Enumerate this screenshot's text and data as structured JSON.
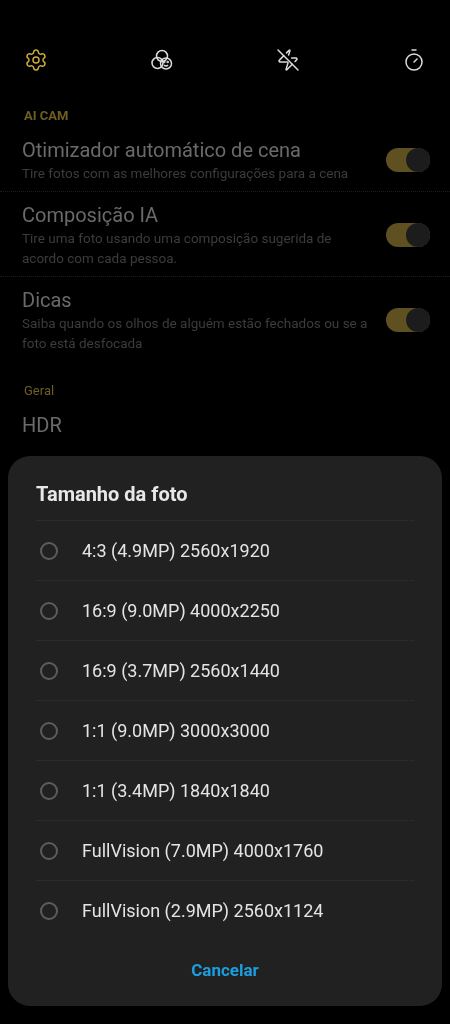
{
  "toolbar": [
    {
      "kind": "settings",
      "selected": true
    },
    {
      "kind": "filter",
      "selected": false
    },
    {
      "kind": "flash-off",
      "selected": false
    },
    {
      "kind": "timer",
      "selected": false
    }
  ],
  "sections": [
    {
      "header": "AI CAM",
      "items": [
        {
          "title": "Otimizador automático de cena",
          "subtitle": "Tire fotos com as melhores configurações para a cena",
          "on": true
        },
        {
          "title": "Composição IA",
          "subtitle": "Tire uma foto usando uma composição sugerida de acordo com cada pessoa.",
          "on": true
        },
        {
          "title": "Dicas",
          "subtitle": "Saiba quando os olhos de alguém estão fechados ou se a foto está desfocada",
          "on": true
        }
      ]
    },
    {
      "header": "Geral",
      "items": [
        {
          "title": "HDR"
        }
      ]
    }
  ],
  "dialog": {
    "title": "Tamanho da foto",
    "options": [
      {
        "label": "4:3 (4.9MP) 2560x1920",
        "selected": false
      },
      {
        "label": "16:9 (9.0MP) 4000x2250",
        "selected": false
      },
      {
        "label": "16:9 (3.7MP) 2560x1440",
        "selected": false
      },
      {
        "label": "1:1 (9.0MP) 3000x3000",
        "selected": false
      },
      {
        "label": "1:1 (3.4MP) 1840x1840",
        "selected": false
      },
      {
        "label": "FullVision (7.0MP) 4000x1760",
        "selected": false
      },
      {
        "label": "FullVision (2.9MP) 2560x1124",
        "selected": false
      }
    ],
    "cancel": "Cancelar"
  }
}
